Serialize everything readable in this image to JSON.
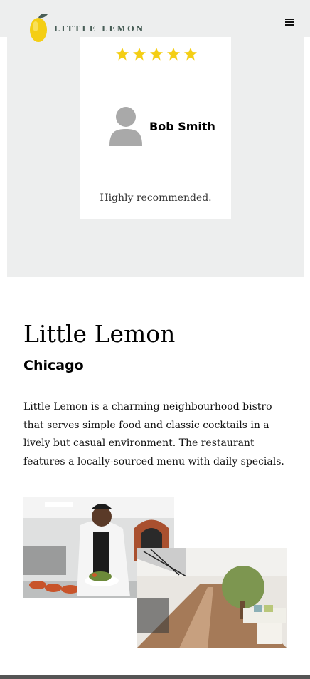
{
  "header": {
    "brand_name": "LITTLE LEMON",
    "logo_icon": "lemon-logo-icon",
    "menu_icon": "hamburger-menu-icon"
  },
  "testimonial": {
    "rating": 5,
    "rating_max": 5,
    "reviewer_name": "Bob Smith",
    "review_text": "Highly recommended.",
    "avatar_icon": "user-avatar-icon"
  },
  "about": {
    "title": "Little Lemon",
    "subtitle": "Chicago",
    "description": "Little Lemon is a charming neighbourhood bistro that serves simple food and classic cocktails in a lively but casual environment. The restaurant features a locally-sourced menu with daily specials."
  },
  "colors": {
    "section_bg": "#edeeee",
    "star": "#f4ce14",
    "brand_green": "#495e57",
    "avatar": "#a9a9a9"
  }
}
